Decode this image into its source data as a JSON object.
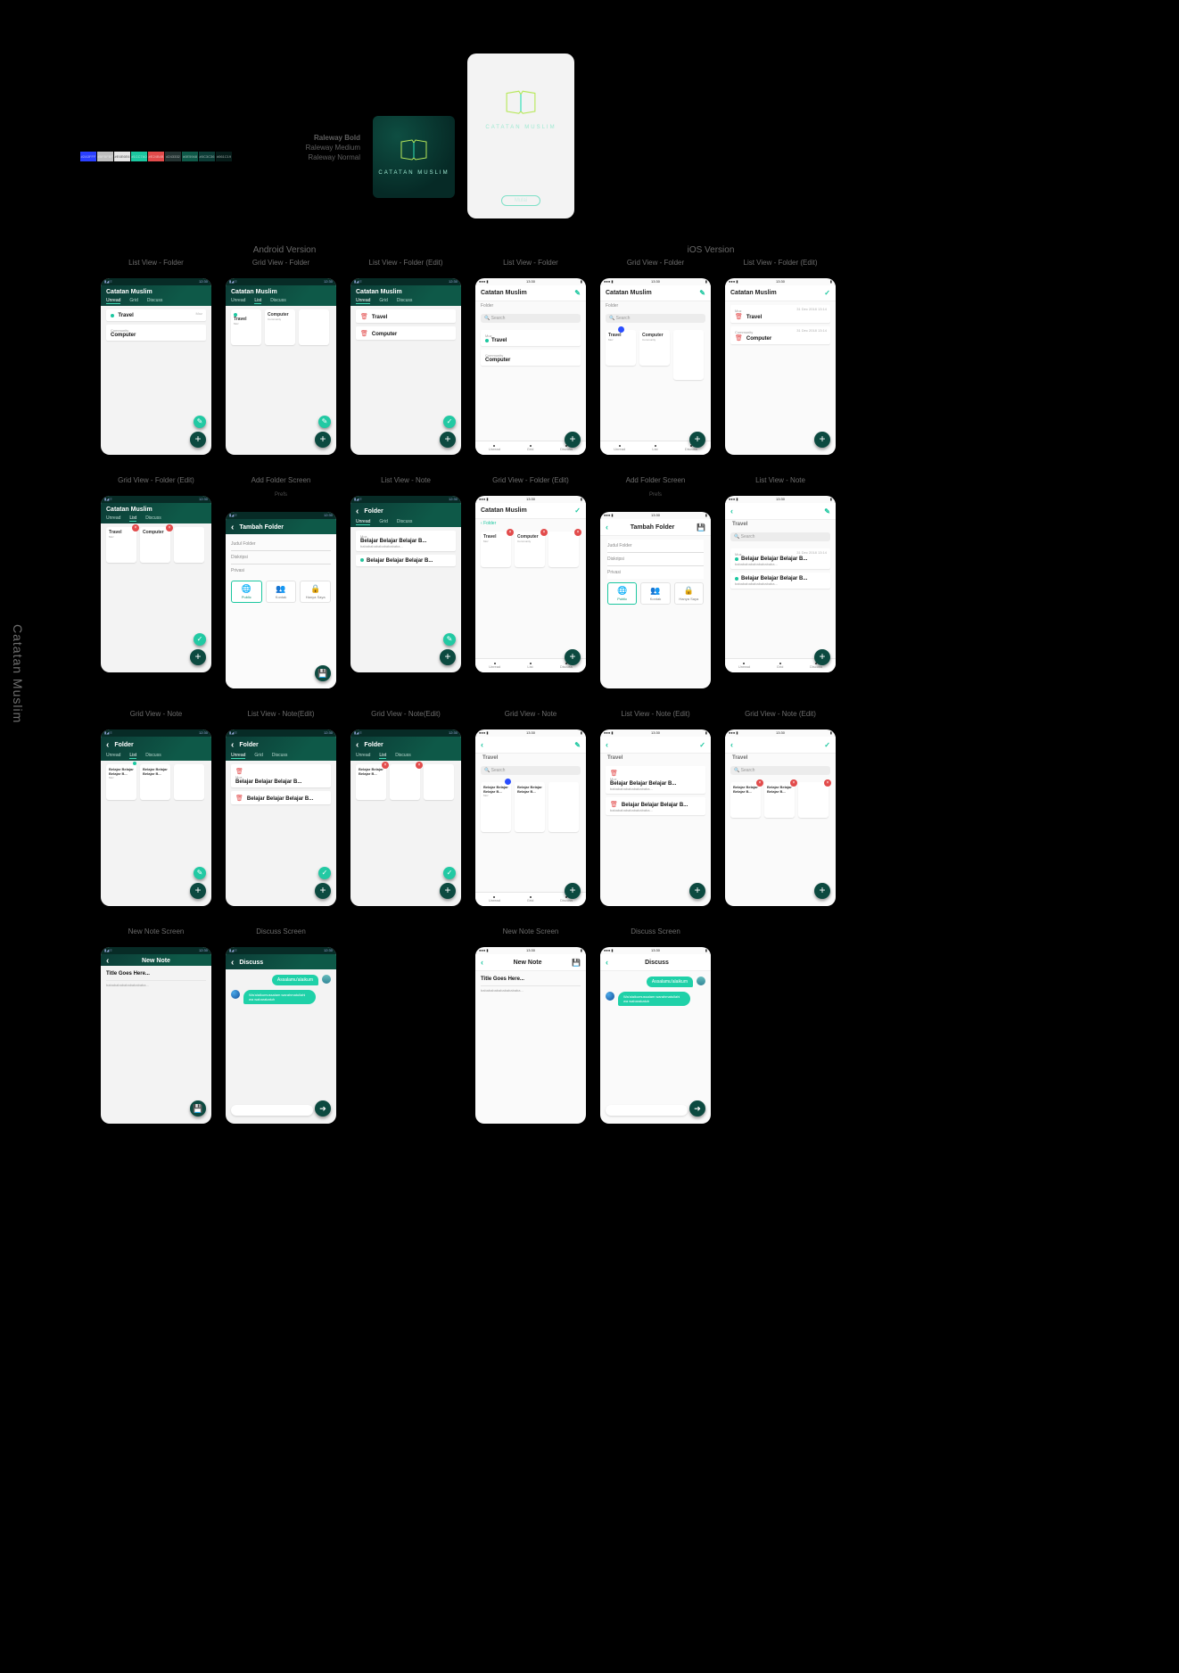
{
  "project_name": "Catatan Muslim",
  "typography": {
    "line1": "Raleway Bold",
    "line2": "Raleway Medium",
    "line3": "Raleway Normal"
  },
  "swatches": [
    {
      "hex": "#2a3fff",
      "name": "#2A3FFF"
    },
    {
      "hex": "#bfbfbf",
      "name": "#BFBFBF"
    },
    {
      "hex": "#e6e6e6",
      "name": "#E6E6E6"
    },
    {
      "hex": "#1cc7a0",
      "name": "#1CC7A0"
    },
    {
      "hex": "#e24b4b",
      "name": "#E24B4B"
    },
    {
      "hex": "#243332",
      "name": "#243332"
    },
    {
      "hex": "#0e5948",
      "name": "#0E5948"
    },
    {
      "hex": "#0c3c36",
      "name": "#0C3C36"
    },
    {
      "hex": "#061c19",
      "name": "#061C19"
    }
  ],
  "logo_brand": "CATATAN MUSLIM",
  "splash": {
    "brand": "CATATAN MUSLIM",
    "cta": "Mulai"
  },
  "sections": {
    "android": "Android Version",
    "ios": "iOS Version"
  },
  "tabs": {
    "unread": "Unread",
    "grid": "Grid",
    "list": "List",
    "discuss": "Discuss"
  },
  "labels": {
    "folder": "Folder",
    "travel": "Travel",
    "computer": "Computer",
    "moz": "Moz",
    "community": "Community",
    "date": "31 Dec 2018 13:14",
    "search": "Search",
    "tambah_folder": "Tambah Folder",
    "judul": "Judul Folder",
    "diskripsi": "Diskripsi",
    "privasi": "Privasi",
    "public": "Public",
    "kontak": "Kontak",
    "hanya_saya": "Hanya Saya",
    "note_title": "Belajar Belajar Belajar B...",
    "note_sub": "babababababababababa...",
    "new_folder_prefs": "Prefs",
    "new_note": "New Note",
    "discuss": "Discuss",
    "title_goes": "Title Goes Here...",
    "msg1": "Assalamu'alaikum",
    "msg2": "Wa'alaikumussalam warahmatullahi wa wabarakatuh"
  },
  "captions": {
    "r1c1": "List View - Folder",
    "r1c2": "Grid View - Folder",
    "r1c3": "List View - Folder (Edit)",
    "r1c4": "List View - Folder",
    "r1c5": "Grid View - Folder",
    "r1c6": "List View - Folder (Edit)",
    "r2c1": "Grid View - Folder (Edit)",
    "r2c2": "Add Folder Screen",
    "r2c3": "List View - Note",
    "r2c4": "Grid View - Folder (Edit)",
    "r2c5": "Add Folder Screen",
    "r2c6": "List View - Note",
    "r3c1": "Grid View - Note",
    "r3c2": "List View - Note(Edit)",
    "r3c3": "Grid View - Note(Edit)",
    "r3c4": "Grid View - Note",
    "r3c5": "List View - Note (Edit)",
    "r3c6": "Grid View - Note (Edit)",
    "r4c1": "New Note Screen",
    "r4c2": "Discuss Screen",
    "r4c4": "New Note Screen",
    "r4c5": "Discuss Screen"
  },
  "status": {
    "time_a": "12:30",
    "sig": "▮◢ ≡",
    "time_i": "13:30",
    "sig_i": "●●● ▮"
  }
}
